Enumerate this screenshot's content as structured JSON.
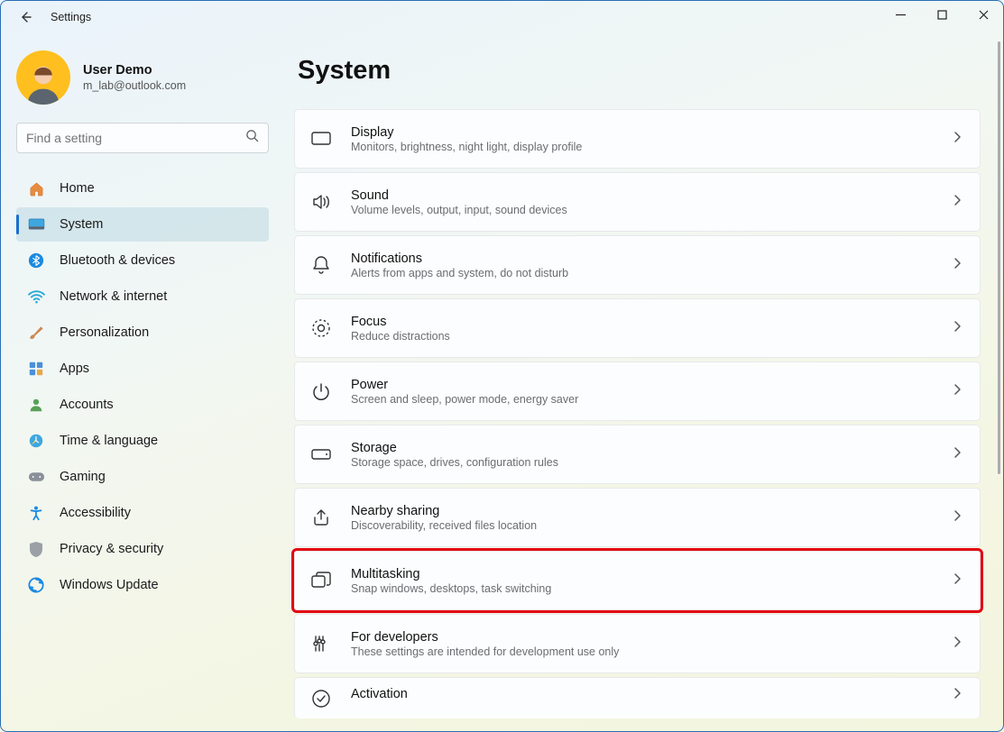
{
  "window": {
    "title": "Settings"
  },
  "user": {
    "name": "User Demo",
    "email": "m_lab@outlook.com"
  },
  "search": {
    "placeholder": "Find a setting"
  },
  "nav": {
    "items": [
      {
        "id": "home",
        "label": "Home"
      },
      {
        "id": "system",
        "label": "System",
        "selected": true
      },
      {
        "id": "bluetooth",
        "label": "Bluetooth & devices"
      },
      {
        "id": "network",
        "label": "Network & internet"
      },
      {
        "id": "personalization",
        "label": "Personalization"
      },
      {
        "id": "apps",
        "label": "Apps"
      },
      {
        "id": "accounts",
        "label": "Accounts"
      },
      {
        "id": "time",
        "label": "Time & language"
      },
      {
        "id": "gaming",
        "label": "Gaming"
      },
      {
        "id": "accessibility",
        "label": "Accessibility"
      },
      {
        "id": "privacy",
        "label": "Privacy & security"
      },
      {
        "id": "update",
        "label": "Windows Update"
      }
    ]
  },
  "page": {
    "title": "System"
  },
  "cards": [
    {
      "id": "display",
      "title": "Display",
      "desc": "Monitors, brightness, night light, display profile"
    },
    {
      "id": "sound",
      "title": "Sound",
      "desc": "Volume levels, output, input, sound devices"
    },
    {
      "id": "notifications",
      "title": "Notifications",
      "desc": "Alerts from apps and system, do not disturb"
    },
    {
      "id": "focus",
      "title": "Focus",
      "desc": "Reduce distractions"
    },
    {
      "id": "power",
      "title": "Power",
      "desc": "Screen and sleep, power mode, energy saver"
    },
    {
      "id": "storage",
      "title": "Storage",
      "desc": "Storage space, drives, configuration rules"
    },
    {
      "id": "nearby",
      "title": "Nearby sharing",
      "desc": "Discoverability, received files location"
    },
    {
      "id": "multitasking",
      "title": "Multitasking",
      "desc": "Snap windows, desktops, task switching",
      "highlight": true
    },
    {
      "id": "developers",
      "title": "For developers",
      "desc": "These settings are intended for development use only"
    },
    {
      "id": "activation",
      "title": "Activation",
      "desc": ""
    }
  ]
}
